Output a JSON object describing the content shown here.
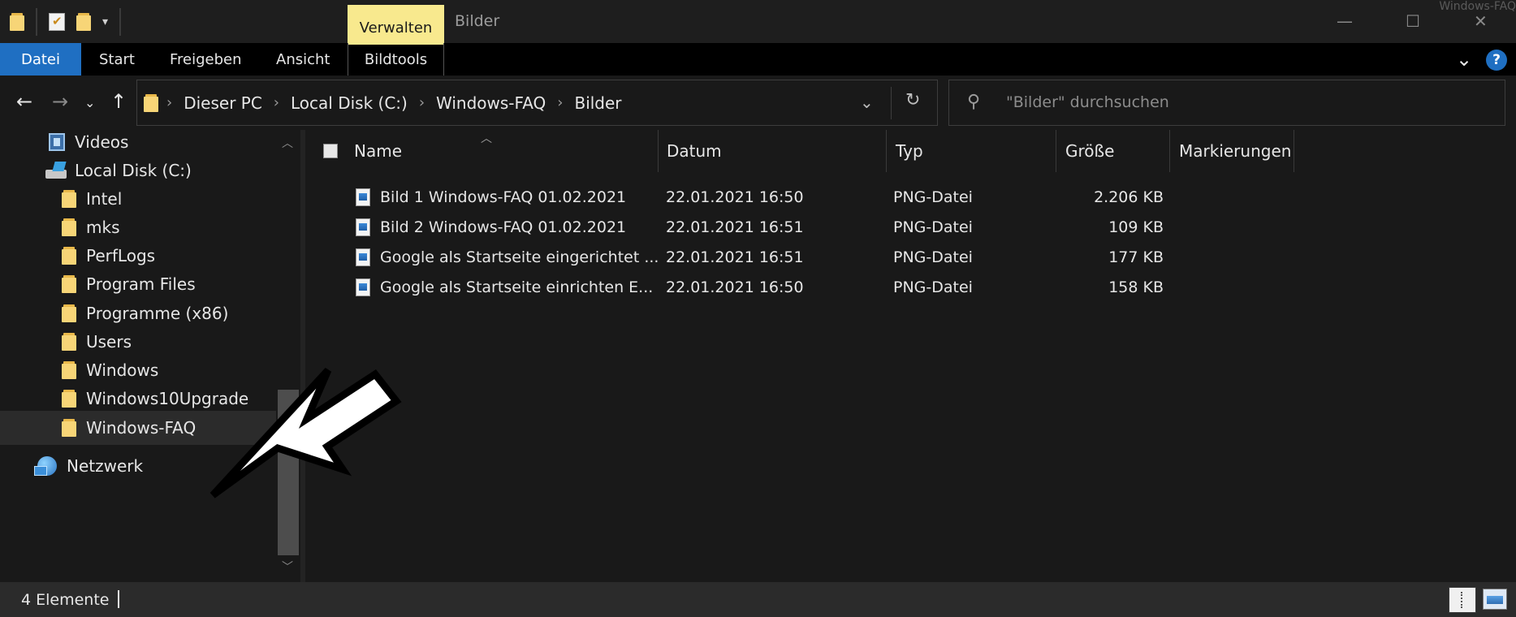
{
  "window": {
    "title": "Bilder",
    "context_tab": "Verwalten",
    "watermark": "Windows-FAQ"
  },
  "ribbon": {
    "tabs": [
      {
        "label": "Datei"
      },
      {
        "label": "Start"
      },
      {
        "label": "Freigeben"
      },
      {
        "label": "Ansicht"
      },
      {
        "label": "Bildtools"
      }
    ],
    "help_label": "?"
  },
  "address": {
    "crumbs": [
      "Dieser PC",
      "Local Disk (C:)",
      "Windows-FAQ",
      "Bilder"
    ]
  },
  "search": {
    "placeholder": "\"Bilder\" durchsuchen"
  },
  "navpane": {
    "items": [
      {
        "label": "Videos",
        "icon": "video-folder-icon"
      },
      {
        "label": "Local Disk (C:)",
        "icon": "drive-icon"
      },
      {
        "label": "Intel",
        "icon": "folder-icon"
      },
      {
        "label": "mks",
        "icon": "folder-icon"
      },
      {
        "label": "PerfLogs",
        "icon": "folder-icon"
      },
      {
        "label": "Program Files",
        "icon": "folder-icon"
      },
      {
        "label": "Programme (x86)",
        "icon": "folder-icon"
      },
      {
        "label": "Users",
        "icon": "folder-icon"
      },
      {
        "label": "Windows",
        "icon": "folder-icon"
      },
      {
        "label": "Windows10Upgrade",
        "icon": "folder-icon"
      },
      {
        "label": "Windows-FAQ",
        "icon": "folder-icon",
        "selected": true
      },
      {
        "label": "Netzwerk",
        "icon": "network-icon"
      }
    ]
  },
  "list": {
    "columns": [
      "Name",
      "Datum",
      "Typ",
      "Größe",
      "Markierungen"
    ],
    "rows": [
      {
        "name": "Bild 1 Windows-FAQ 01.02.2021",
        "date": "22.01.2021 16:50",
        "type": "PNG-Datei",
        "size": "2.206 KB"
      },
      {
        "name": "Bild 2 Windows-FAQ 01.02.2021",
        "date": "22.01.2021 16:51",
        "type": "PNG-Datei",
        "size": "109 KB"
      },
      {
        "name": "Google als Startseite eingerichtet ...",
        "date": "22.01.2021 16:51",
        "type": "PNG-Datei",
        "size": "177 KB"
      },
      {
        "name": "Google als Startseite einrichten E...",
        "date": "22.01.2021 16:50",
        "type": "PNG-Datei",
        "size": "158 KB"
      }
    ]
  },
  "status": {
    "count_text": "4 Elemente"
  },
  "colors": {
    "accent": "#1f6fc2",
    "context_tab": "#f8e98e",
    "folder": "#f7d577"
  }
}
